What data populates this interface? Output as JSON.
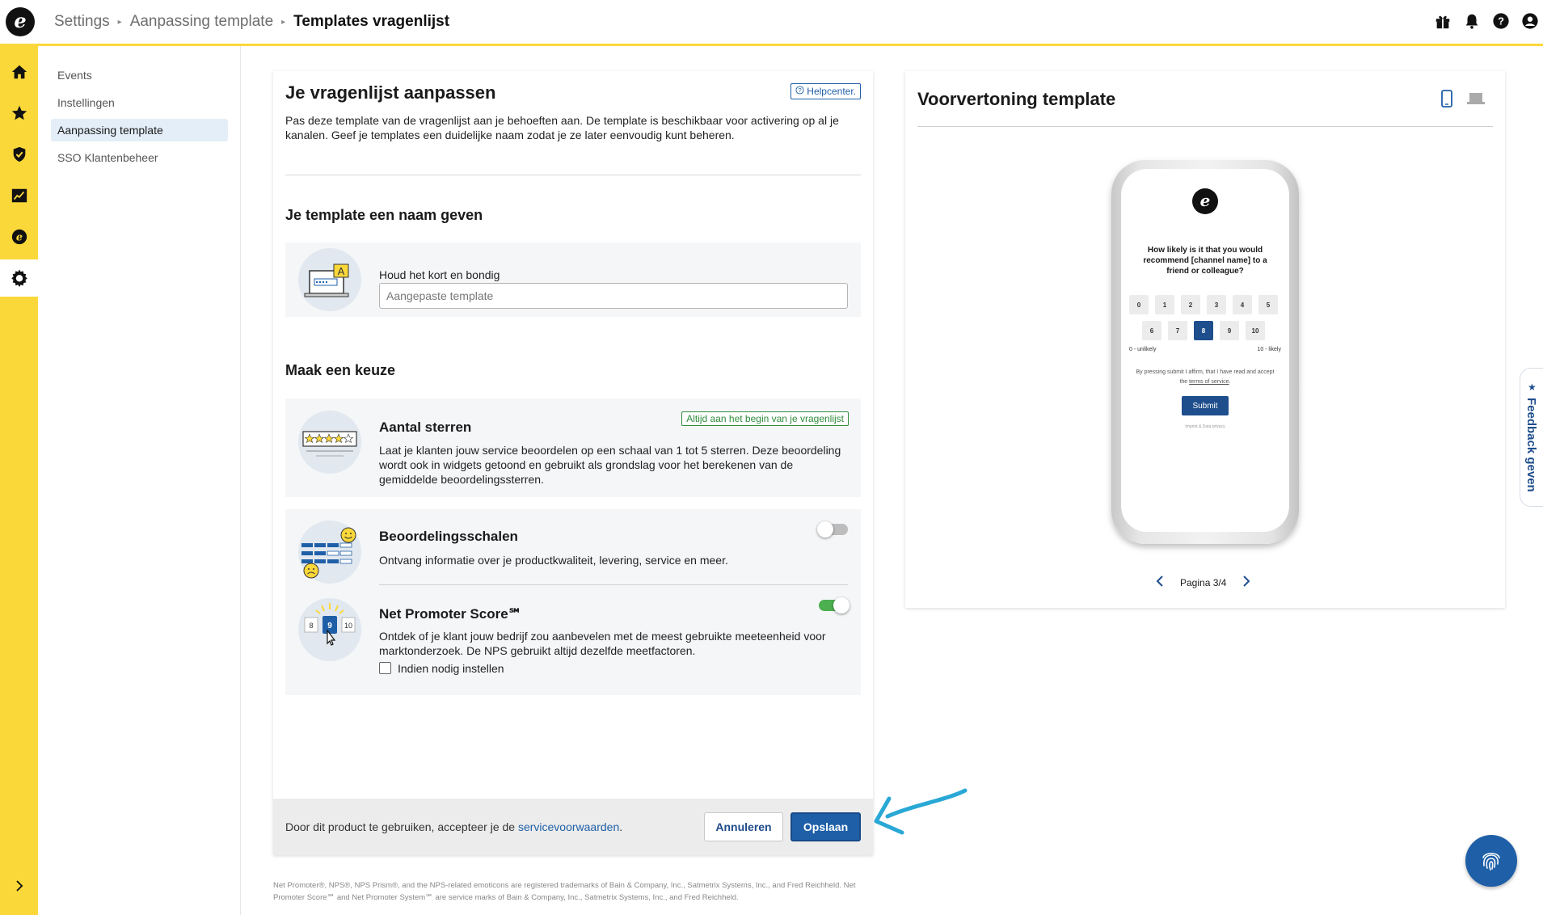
{
  "breadcrumbs": [
    "Settings",
    "Aanpassing template",
    "Templates vragenlijst"
  ],
  "top_icons": [
    "gift-icon",
    "bell-icon",
    "help-icon",
    "account-icon"
  ],
  "rail_icons": [
    "home-icon",
    "star-icon",
    "shield-icon",
    "chart-icon",
    "ekomi-icon",
    "gear-icon",
    "expand-icon"
  ],
  "subnav": {
    "items": [
      {
        "label": "Events",
        "active": false
      },
      {
        "label": "Instellingen",
        "active": false
      },
      {
        "label": "Aanpassing template",
        "active": true
      },
      {
        "label": "SSO Klantenbeheer",
        "active": false
      }
    ]
  },
  "editor": {
    "title": "Je vragenlijst aanpassen",
    "helpcenter_label": "Helpcenter.",
    "intro": "Pas deze template van de vragenlijst aan je behoeften aan. De template is beschikbaar voor activering op al je kanalen. Geef je templates een duidelijke naam zodat je ze later eenvoudig kunt beheren.",
    "name_section_title": "Je template een naam geven",
    "name_field_label": "Houd het kort en bondig",
    "name_field_placeholder": "Aangepaste template",
    "name_field_value": "",
    "choice_section_title": "Maak een keuze",
    "options": {
      "stars": {
        "title": "Aantal sterren",
        "badge": "Altijd aan het begin van je vragenlijst",
        "description": "Laat je klanten jouw service beoordelen op een schaal van 1 tot 5 sterren. Deze beoordeling wordt ook in widgets getoond en gebruikt als grondslag voor het berekenen van de gemiddelde beoordelingssterren."
      },
      "scales": {
        "title": "Beoordelingsschalen",
        "description": "Ontvang informatie over je productkwaliteit, levering, service en meer.",
        "enabled": false
      },
      "nps": {
        "title": "Net Promoter Score℠",
        "description": "Ontdek of je klant jouw bedrijf zou aanbevelen met de meest gebruikte meeteenheid voor marktonderzoek. De NPS gebruikt altijd dezelfde meetfactoren.",
        "enabled": true,
        "illustration_numbers": [
          "8",
          "9",
          "10"
        ],
        "checkbox_label": "Indien nodig instellen",
        "checkbox_checked": false
      }
    },
    "footer": {
      "text": "Door dit product te gebruiken, accepteer je de ",
      "link_label": "servicevoorwaarden",
      "text_end": ".",
      "cancel_label": "Annuleren",
      "save_label": "Opslaan"
    }
  },
  "disclaimer": "Net Promoter®, NPS®, NPS Prism®, and the NPS-related emoticons are registered trademarks of Bain & Company, Inc., Satmetrix Systems, Inc., and Fred Reichheld. Net Promoter Score℠ and Net Promoter System℠ are service marks of Bain & Company, Inc., Satmetrix Systems, Inc., and Fred Reichheld.",
  "preview": {
    "title": "Voorvertoning template",
    "question": "How likely is it that you would recommend [channel name] to a friend or colleague?",
    "scale_numbers": [
      "0",
      "1",
      "2",
      "3",
      "4",
      "5",
      "6",
      "7",
      "8",
      "9",
      "10"
    ],
    "selected": "8",
    "low_label": "0 - unlikely",
    "high_label": "10 - likely",
    "terms_text": "By pressing submit I affirm, that I have read and accept the",
    "terms_link": "terms of service",
    "submit_label": "Submit",
    "imprint": "Imprint & Data privacy",
    "pager_label": "Pagina 3/4"
  },
  "feedback_tab_label": "Feedback geven",
  "colors": {
    "accent_yellow": "#fbd839",
    "primary_blue": "#1e5fa8",
    "toggle_on": "#4caf50"
  }
}
